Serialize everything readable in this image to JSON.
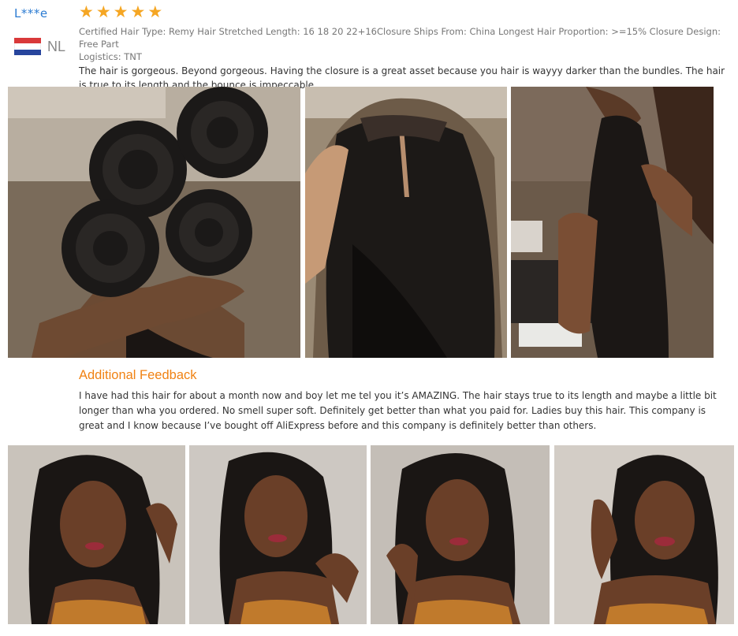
{
  "reviewer": {
    "name": "L***e",
    "country": "NL",
    "flag_colors": [
      "#d9393a",
      "#ffffff",
      "#27459d"
    ]
  },
  "review": {
    "rating": 5,
    "star_color": "#f5a623",
    "meta_line1": "Certified Hair Type: Remy Hair Stretched Length: 16 18 20 22+16Closure Ships From: China Longest Hair Proportion: >=15% Closure Design: Free Part",
    "meta_line2": "Logistics: TNT",
    "text": "The hair is gorgeous. Beyond gorgeous. Having the closure is a great asset because you hair is wayyy darker than the bundles. The hair is true to its length and the bounce is impeccable."
  },
  "review_photos": [
    {
      "subject": "four rolled hair bundles held in hand"
    },
    {
      "subject": "lace closure with middle part"
    },
    {
      "subject": "straight hair bundle held up"
    }
  ],
  "additional_feedback": {
    "title": "Additional Feedback",
    "title_color": "#f08213",
    "text": "I have had this hair for about a month now and boy let me tel you it’s AMAZING. The hair stays true to its length and maybe a little bit longer than wha you ordered. No smell super soft. Definitely get better than what you paid for. Ladies buy this hair. This company is great and I know because I’ve bought off AliExpress before and this company is definitely better than others."
  },
  "feedback_photos": [
    {
      "subject": "woman wearing straight bob wig"
    },
    {
      "subject": "woman wearing straight bob wig"
    },
    {
      "subject": "woman wearing straight bob wig"
    },
    {
      "subject": "woman wearing straight bob wig"
    }
  ]
}
